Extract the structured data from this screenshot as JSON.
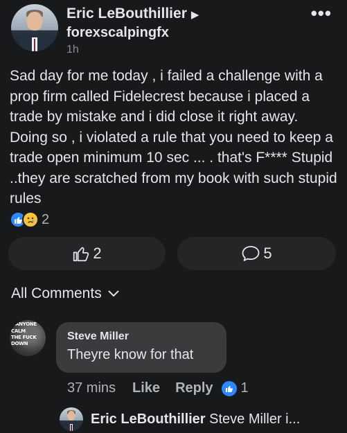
{
  "post": {
    "author": "Eric LeBouthillier",
    "page": "forexscalpingfx",
    "time": "1h",
    "more_label": "•••",
    "text": "Sad day for me today , i failed a challenge with a prop firm called Fidelecrest because i placed a trade by mistake and i did close it right away. Doing so , i violated a rule that you need to keep a trade open minimum 10 sec ... . that's F**** Stupid ..they are scratched from my book with such stupid rules",
    "reaction_count": "2",
    "like_count": "2",
    "comment_count": "5"
  },
  "comments_header": "All Comments",
  "comment": {
    "avatar_text": [
      "ANYONE",
      "CALM",
      "THE FUCK",
      "DOWN"
    ],
    "author": "Steve Miller",
    "text": "Theyre know for that",
    "time": "37 mins",
    "like_label": "Like",
    "reply_label": "Reply",
    "like_count": "1"
  },
  "reply_preview": {
    "author": "Eric LeBouthillier",
    "text": "Steve Miller i..."
  },
  "colors": {
    "background": "#18191a",
    "button": "#242526",
    "bubble": "#3a3b3c",
    "like_blue": "#2d88ff",
    "sad_yellow": "#f7c33c"
  },
  "icons": [
    "thumbs-up-icon",
    "sad-face-icon",
    "comment-bubble-icon",
    "chevron-down-icon",
    "play-arrow-icon",
    "more-dots-icon"
  ]
}
